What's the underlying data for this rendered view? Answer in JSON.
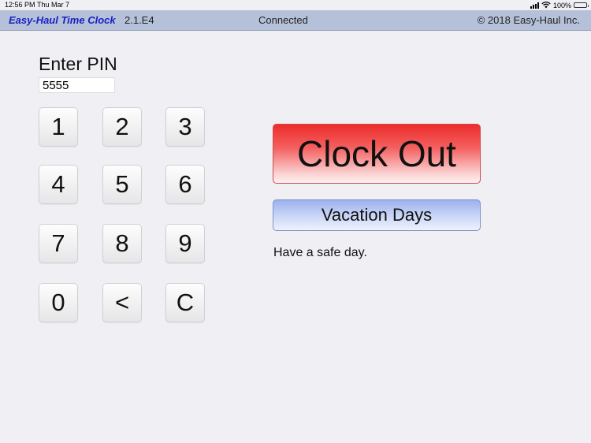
{
  "status_bar": {
    "time": "12:56 PM",
    "date": "Thu Mar 7",
    "battery": "100%",
    "battery_level": 1.0,
    "icons": [
      "signal-icon",
      "wifi-icon",
      "battery-icon"
    ]
  },
  "header": {
    "app_title": "Easy-Haul Time Clock",
    "version": "2.1.E4",
    "connection_status": "Connected",
    "copyright": "© 2018 Easy-Haul Inc."
  },
  "pin": {
    "label": "Enter PIN",
    "value": "5555"
  },
  "keypad": {
    "keys": [
      "1",
      "2",
      "3",
      "4",
      "5",
      "6",
      "7",
      "8",
      "9",
      "0",
      "<",
      "C"
    ]
  },
  "actions": {
    "clock_out_label": "Clock Out",
    "vacation_label": "Vacation Days"
  },
  "message": "Have a safe day.",
  "colors": {
    "header_bg": "#b5c1d8",
    "title_blue": "#1a1fc4",
    "clock_out_red": "#ec2d2b",
    "vacation_blue": "#9bb0ee",
    "background": "#efeff4"
  }
}
